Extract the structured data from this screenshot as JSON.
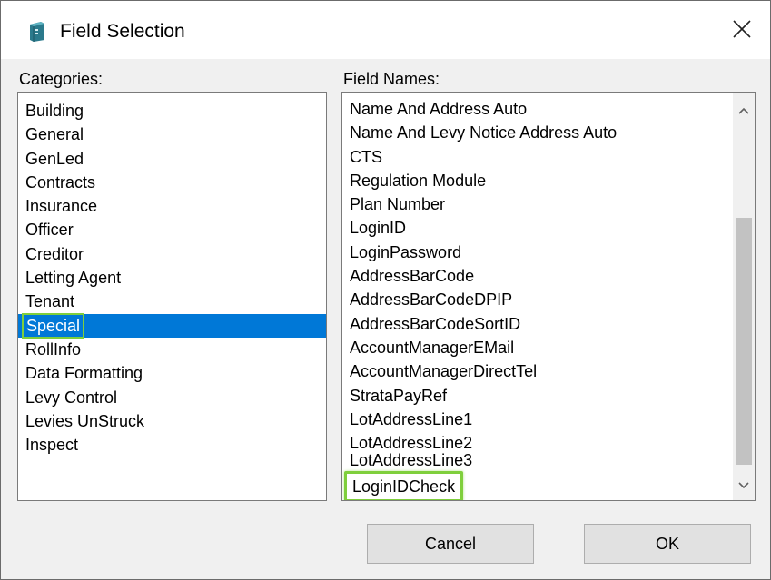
{
  "window": {
    "title": "Field Selection",
    "app_icon": "database-icon",
    "close_icon": "close-icon"
  },
  "categories": {
    "label": "Categories:",
    "items": [
      "Building",
      "General",
      "GenLed",
      "Contracts",
      "Insurance",
      "Officer",
      "Creditor",
      "Letting Agent",
      "Tenant",
      "Special",
      "RollInfo",
      "Data Formatting",
      "Levy Control",
      "Levies UnStruck",
      "Inspect"
    ],
    "selected": "Special"
  },
  "fields": {
    "label": "Field Names:",
    "items": [
      "Name And Address Auto",
      "Name And Levy Notice Address Auto",
      "CTS",
      "Regulation Module",
      "Plan Number",
      "LoginID",
      "LoginPassword",
      "AddressBarCode",
      "AddressBarCodeDPIP",
      "AddressBarCodeSortID",
      "AccountManagerEMail",
      "AccountManagerDirectTel",
      "StrataPayRef",
      "LotAddressLine1",
      "LotAddressLine2"
    ],
    "partial_item": "LotAddressLine3",
    "highlighted_item": "LoginIDCheck"
  },
  "buttons": {
    "cancel": "Cancel",
    "ok": "OK"
  },
  "colors": {
    "selection": "#0078d7",
    "highlight_outline": "#7fcf3c"
  }
}
